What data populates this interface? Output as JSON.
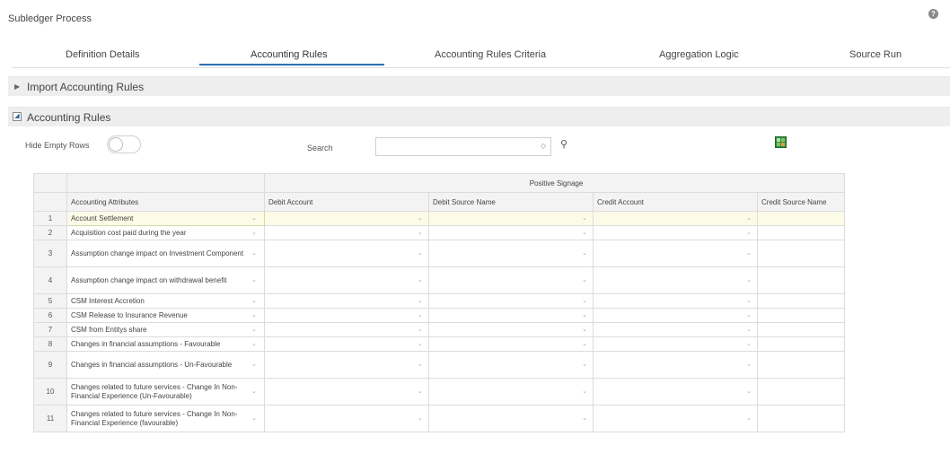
{
  "page": {
    "title": "Subledger Process",
    "help_icon": "help-icon"
  },
  "tabs": [
    {
      "label": "Definition Details"
    },
    {
      "label": "Accounting Rules",
      "active": true
    },
    {
      "label": "Accounting Rules Criteria"
    },
    {
      "label": "Aggregation Logic"
    },
    {
      "label": "Source Run"
    }
  ],
  "sections": {
    "import": {
      "label": "Import Accounting Rules"
    },
    "rules": {
      "label": "Accounting Rules"
    }
  },
  "controls": {
    "hide_empty_label": "Hide Empty Rows",
    "search_label": "Search",
    "search_value": "",
    "export_icon": "excel-icon"
  },
  "grid": {
    "group_header": "Positive Signage",
    "columns": [
      "Accounting Attributes",
      "Debit Account",
      "Debit Source Name",
      "Credit Account",
      "Credit Source Name"
    ],
    "rows": [
      {
        "num": "1",
        "attr": "Account Settlement"
      },
      {
        "num": "2",
        "attr": "Acquisition cost paid during the year"
      },
      {
        "num": "3",
        "attr": "Assumption change impact on Investment Component"
      },
      {
        "num": "4",
        "attr": "Assumption change impact on withdrawal benefit"
      },
      {
        "num": "5",
        "attr": "CSM Interest Accretion"
      },
      {
        "num": "6",
        "attr": "CSM Release to Insurance Revenue"
      },
      {
        "num": "7",
        "attr": "CSM from Entitys share"
      },
      {
        "num": "8",
        "attr": "Changes in financial assumptions - Favourable"
      },
      {
        "num": "9",
        "attr": "Changes in financial assumptions - Un-Favourable"
      },
      {
        "num": "10",
        "attr": "Changes related to future services - Change In Non-Financial Experience (Un-Favourable)"
      },
      {
        "num": "11",
        "attr": "Changes related to future services - Change In Non-Financial Experience (favourable)"
      }
    ]
  }
}
